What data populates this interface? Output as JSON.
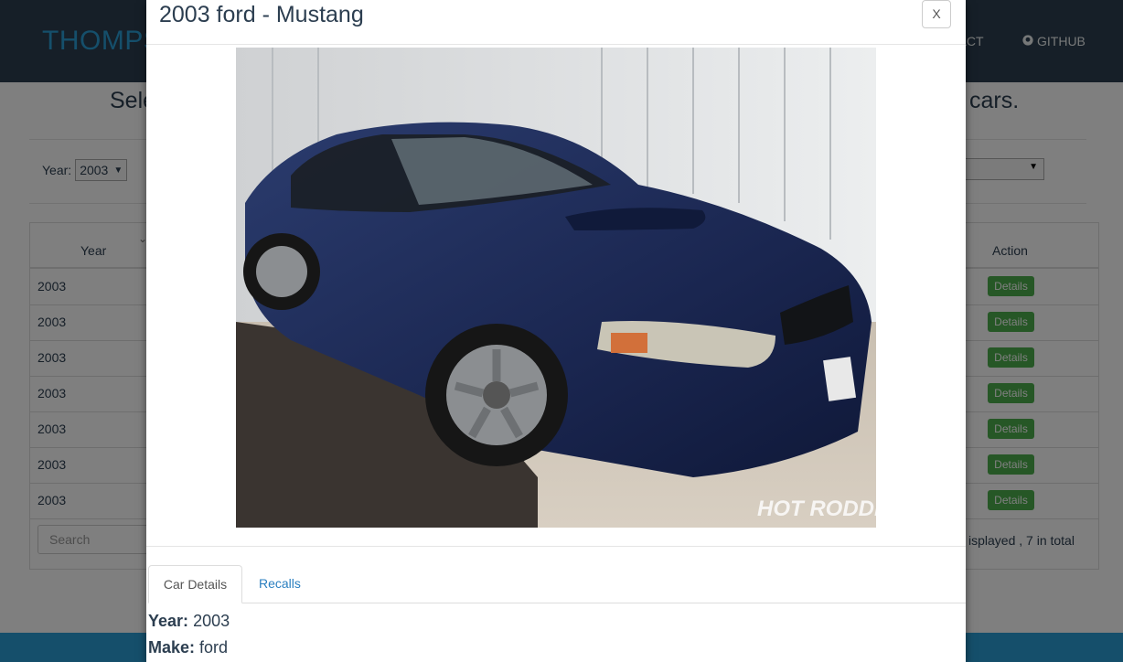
{
  "navbar": {
    "brand": "THOMPS",
    "contact_label": "TACT",
    "github_label": "GITHUB"
  },
  "page": {
    "heading_left": "Sele",
    "heading_right": "cars.",
    "year_filter": {
      "label": "Year:",
      "value": "2003"
    },
    "table": {
      "headers": {
        "year": "Year",
        "action": "Action"
      },
      "rows": [
        {
          "year": "2003",
          "action": "Details"
        },
        {
          "year": "2003",
          "action": "Details"
        },
        {
          "year": "2003",
          "action": "Details"
        },
        {
          "year": "2003",
          "action": "Details"
        },
        {
          "year": "2003",
          "action": "Details"
        },
        {
          "year": "2003",
          "action": "Details"
        },
        {
          "year": "2003",
          "action": "Details"
        }
      ],
      "search_placeholder": "Search",
      "page_info": "isplayed , 7 in total"
    }
  },
  "modal": {
    "title": "2003 ford - Mustang",
    "close_label": "X",
    "image_watermark": "HOT RODDING",
    "tabs": [
      {
        "label": "Car Details",
        "active": true
      },
      {
        "label": "Recalls",
        "active": false
      }
    ],
    "details": [
      {
        "label": "Year:",
        "value": "2003"
      },
      {
        "label": "Make:",
        "value": "ford"
      }
    ]
  },
  "colors": {
    "navbar": "#2c3e50",
    "brand": "#2a9fd6",
    "details_button": "#4cae4c",
    "footer": "#2a9fd6",
    "car_body": "#1c2a55"
  }
}
